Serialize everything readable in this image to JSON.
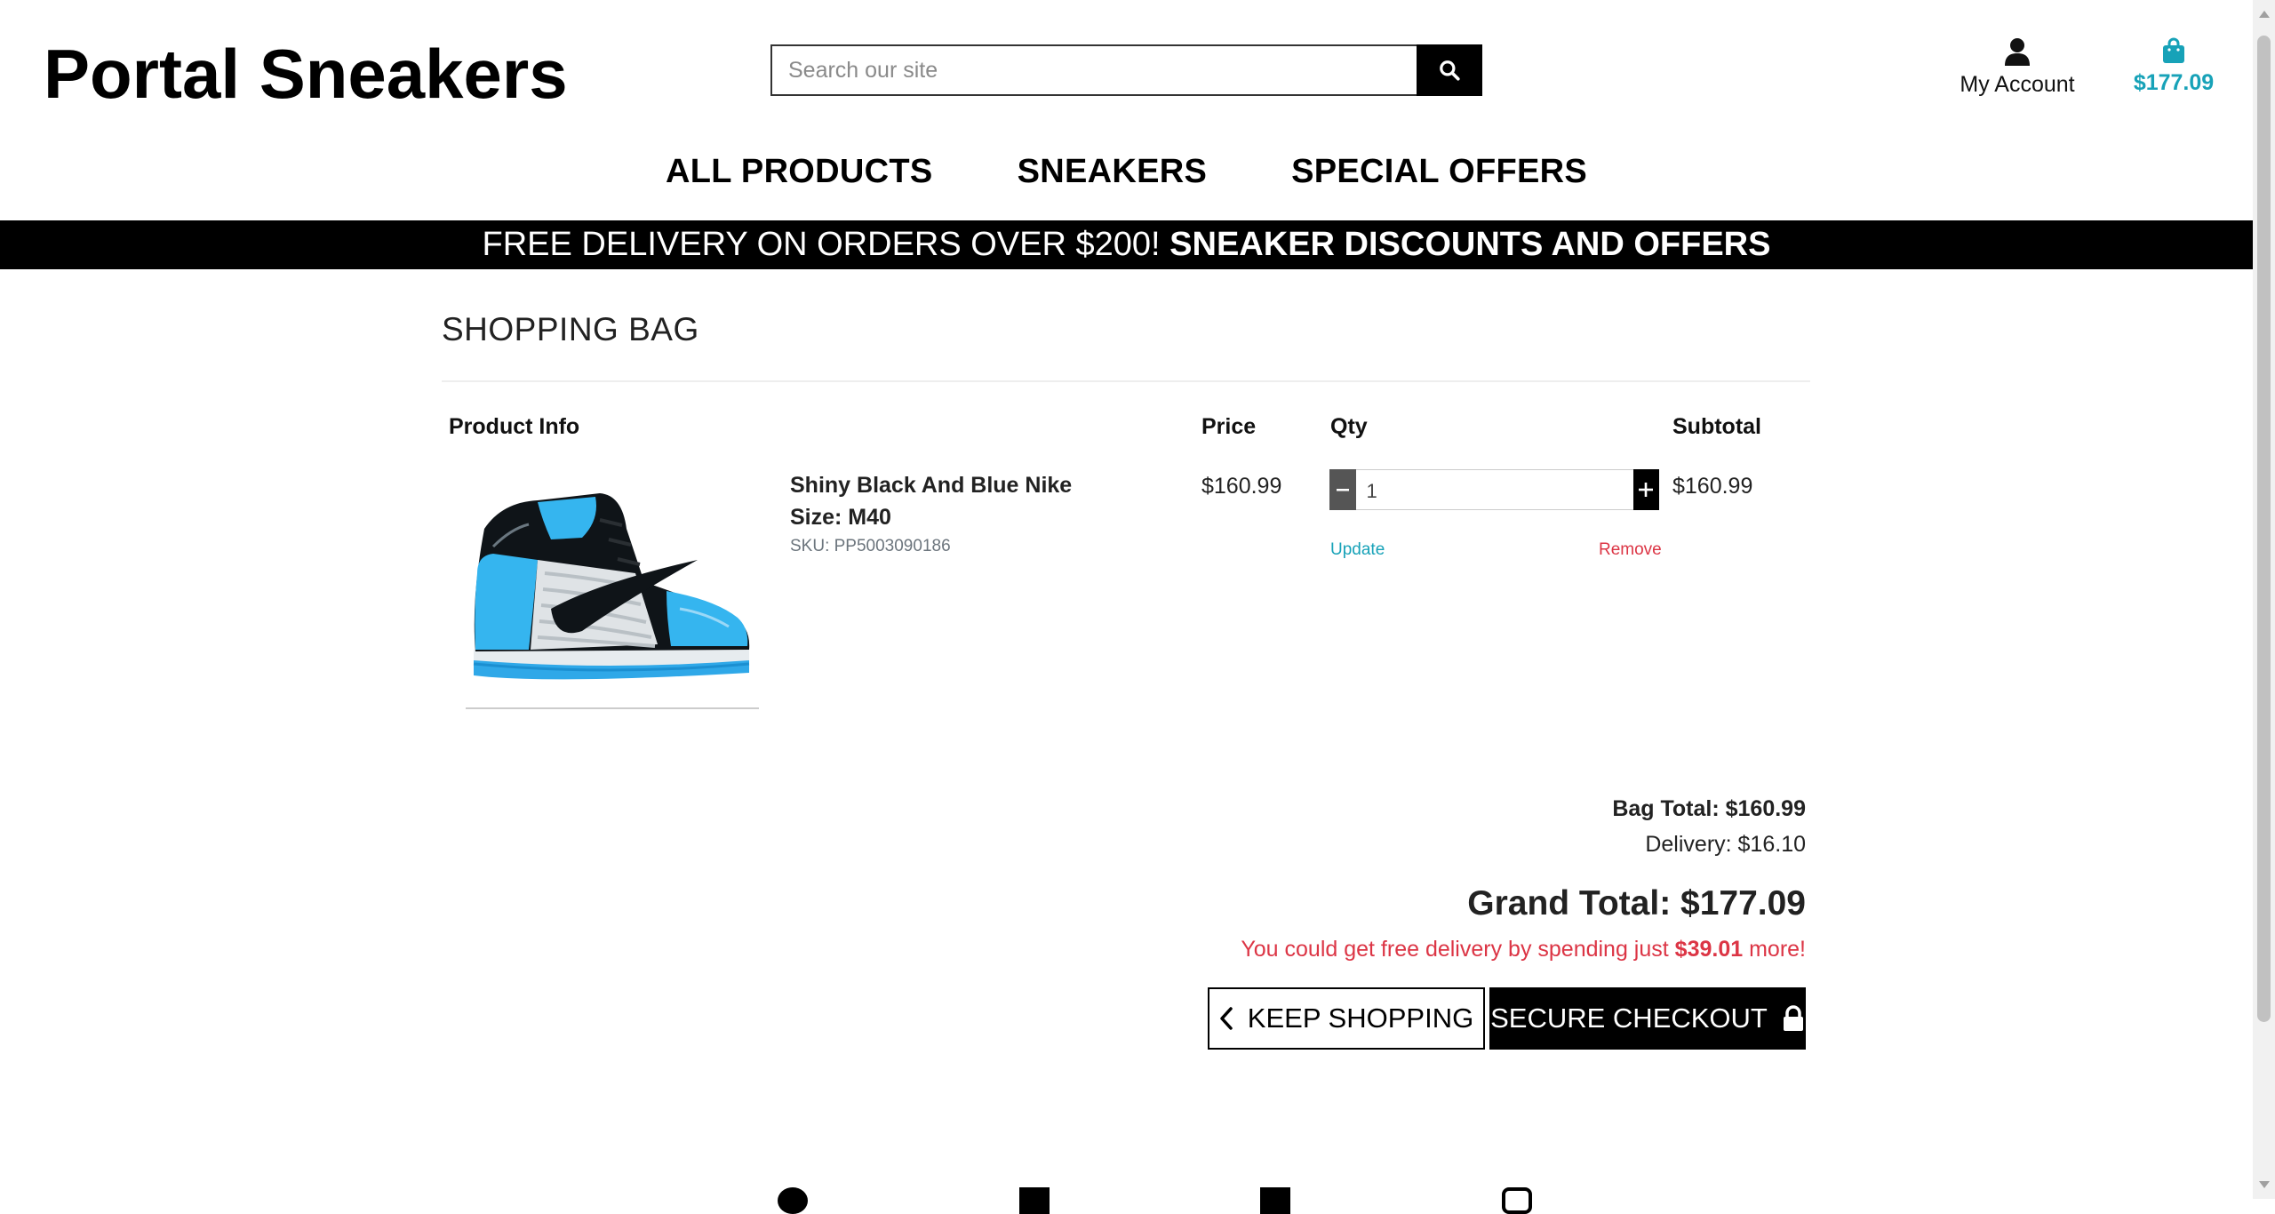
{
  "header": {
    "brand": "Portal Sneakers",
    "search": {
      "placeholder": "Search our site",
      "button_icon": "search-icon"
    },
    "account": {
      "label": "My Account",
      "icon": "user-icon"
    },
    "bag": {
      "amount": "$177.09",
      "icon": "shopping-bag-icon",
      "color": "#17a2b8"
    }
  },
  "nav": {
    "items": [
      {
        "label": "ALL PRODUCTS"
      },
      {
        "label": "SNEAKERS"
      },
      {
        "label": "SPECIAL OFFERS"
      }
    ]
  },
  "banner": {
    "text": "FREE DELIVERY ON ORDERS OVER $200!",
    "bold_text": "SNEAKER DISCOUNTS AND OFFERS"
  },
  "bag_page": {
    "title": "SHOPPING BAG",
    "columns": [
      "Product Info",
      "Price",
      "Qty",
      "Subtotal"
    ],
    "items": [
      {
        "name": "Shiny Black And Blue Nike",
        "size": "Size: M40",
        "sku": "SKU: PP5003090186",
        "price": "$160.99",
        "qty": "1",
        "subtotal": "$160.99",
        "update_label": "Update",
        "remove_label": "Remove"
      }
    ],
    "totals": {
      "bag_total": "Bag Total: $160.99",
      "delivery": "Delivery: $16.10",
      "grand_total": "Grand Total: $177.09",
      "free_delivery_prefix": "You could get free delivery by spending just",
      "free_delivery_amount": "$39.01",
      "free_delivery_suffix": "more!"
    },
    "buttons": {
      "keep_shopping": "KEEP SHOPPING",
      "secure_checkout": "SECURE CHECKOUT"
    }
  },
  "colors": {
    "accent": "#17a2b8",
    "danger": "#dc3545",
    "banner_bg": "#000000"
  }
}
